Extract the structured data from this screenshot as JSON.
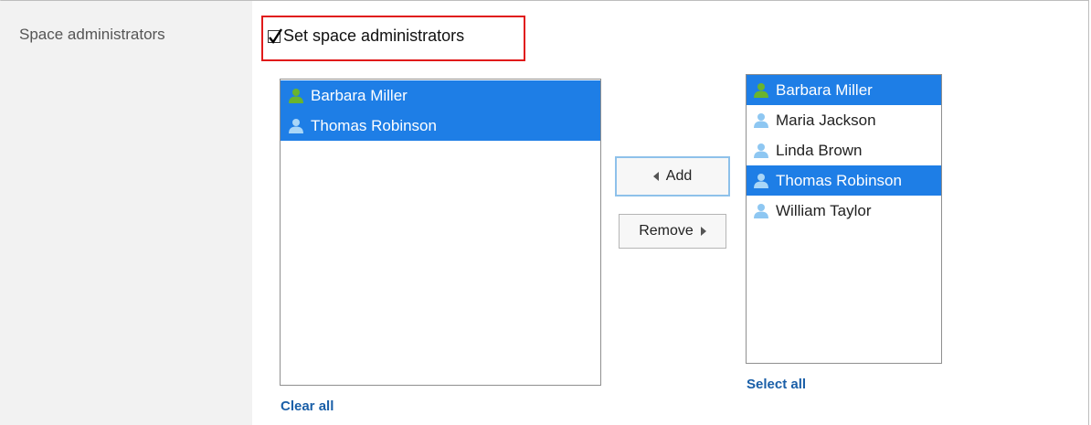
{
  "field": {
    "label": "Space administrators"
  },
  "checkbox": {
    "label": "Set space administrators",
    "checked": true
  },
  "left_list": {
    "items": [
      {
        "name": "Barbara Miller",
        "selected": true,
        "icon": "user-icon-green"
      },
      {
        "name": "Thomas Robinson",
        "selected": true,
        "icon": "user-icon-blue"
      }
    ],
    "clear_all": "Clear all"
  },
  "buttons": {
    "add": "Add",
    "remove": "Remove"
  },
  "right_list": {
    "items": [
      {
        "name": "Barbara Miller",
        "selected": true,
        "icon": "user-icon-green"
      },
      {
        "name": "Maria Jackson",
        "selected": false,
        "icon": "user-icon-blue"
      },
      {
        "name": "Linda Brown",
        "selected": false,
        "icon": "user-icon-blue"
      },
      {
        "name": "Thomas Robinson",
        "selected": true,
        "icon": "user-icon-blue"
      },
      {
        "name": "William Taylor",
        "selected": false,
        "icon": "user-icon-blue"
      }
    ],
    "select_all": "Select all"
  },
  "colors": {
    "selection": "#1e7ee6",
    "highlight_border": "#e01a1a",
    "link": "#1a5fa8",
    "user_green": "#6ab42d",
    "user_blue": "#8ec7f2"
  }
}
